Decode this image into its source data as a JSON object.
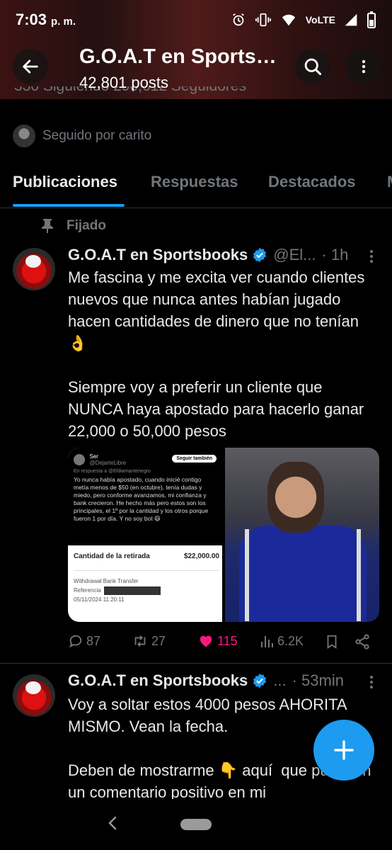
{
  "status": {
    "time": "7:03",
    "ampm": "p. m.",
    "network": "VoLTE"
  },
  "header": {
    "title": "G.O.A.T en Sportsbooks",
    "posts": "42,801 posts",
    "stats_partial": "330 Siguiendo   290,612 Seguidores"
  },
  "profile": {
    "followed_by": "Seguido por carito"
  },
  "tabs": [
    {
      "label": "Publicaciones",
      "active": true
    },
    {
      "label": "Respuestas",
      "active": false
    },
    {
      "label": "Destacados",
      "active": false
    },
    {
      "label": "M",
      "active": false
    }
  ],
  "pinned_label": "Fijado",
  "posts": [
    {
      "name": "G.O.A.T en Sportsbooks",
      "handle": "@El...",
      "time": "· 1h",
      "text": "Me fascina y me excita ver cuando clientes nuevos que nunca antes habían jugado hacen cantidades de dinero que no tenían 👌\n\nSiempre voy a preferir un cliente que NUNCA haya apostado para hacerlo ganar 22,000 o 50,000 pesos",
      "media": {
        "screenshot_name": "Ser",
        "screenshot_handle": "@DejarteLibre",
        "follow_label": "Seguir también",
        "reply_to": "En respuesta a @Eldiamantenegro",
        "screenshot_text": "Yo nunca había apostado, cuando inicié contigo metía menos de $50 (en octubre), tenía dudas y miedo, pero conforme avanzamos, mi confianza y bank crecieron. He hecho más pero estos son los principales, el 1º por la cantidad y los otros porque fueron 1 por día. Y no soy bot 😆",
        "receipt_title": "Cantidad de la retirada",
        "receipt_amount": "$22,000.00",
        "receipt_method": "Withdrawal Bank Transfer",
        "receipt_ref_label": "Referencia",
        "receipt_date": "05/11/2024 11:20:11"
      },
      "actions": {
        "replies": "87",
        "reposts": "27",
        "likes": "115",
        "views": "6.2K"
      }
    },
    {
      "name": "G.O.A.T en Sportsbooks",
      "handle": "...",
      "time": "· 53min",
      "text": "Voy a soltar estos 4000 pesos AHORITA MISMO. Vean la fecha.\n\nDeben de mostrarme 👇 aquí  que pusieron un comentario positivo en mi"
    }
  ],
  "colors": {
    "accent": "#1d9bf0",
    "like": "#f91880",
    "muted": "#71767b",
    "text": "#e7e9ea",
    "background": "#000000"
  },
  "icons": [
    "back-arrow-icon",
    "search-icon",
    "more-vertical-icon",
    "pin-icon",
    "verified-badge-icon",
    "reply-icon",
    "repost-icon",
    "heart-icon",
    "views-icon",
    "bookmark-icon",
    "share-icon",
    "plus-icon"
  ]
}
